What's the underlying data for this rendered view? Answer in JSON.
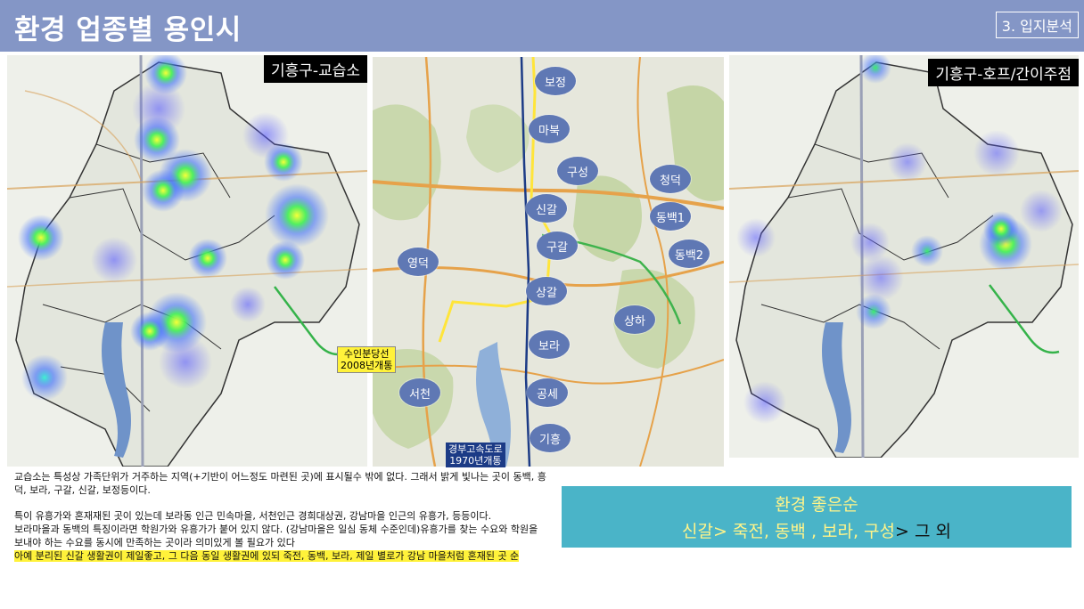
{
  "header": {
    "title": "환경 업종별 용인시",
    "section": "3. 입지분석"
  },
  "maps": {
    "left_label": "기흥구-교습소",
    "right_label": "기흥구-호프/간이주점",
    "center": {
      "districts": [
        "보정",
        "마북",
        "구성",
        "청덕",
        "신갈",
        "동백1",
        "구갈",
        "동백2",
        "영덕",
        "상갈",
        "상하",
        "보라",
        "서천",
        "공세",
        "기흥"
      ],
      "callout_rail": [
        "수인분당선",
        "2008년개통"
      ],
      "callout_highway": [
        "경부고속도로",
        "1970년개통"
      ]
    }
  },
  "text": {
    "p1": "교습소는 특성상 가족단위가 거주하는 지역(+기반이 어느정도 마련된 곳)에 표시될수 밖에 없다. 그래서 밝게 빛나는 곳이 동백, 흥덕, 보라, 구갈, 신갈, 보정등이다.",
    "p2": "특이 유흥가와 혼재재된 곳이 있는데 보라동 인근 민속마을, 서천인근 경희대상권, 강남마을 인근의 유흥가, 등등이다.",
    "p3": "보라마을과 동백의 특징이라면 학원가와 유흥가가 붙어 있지 않다. (강남마을은 일심 동체 수준인데)유흥가를 찾는 수요와 학원을 보내야 하는 수요를 동시에 만족하는 곳이라 의미있게 볼 필요가 있다",
    "p4": "아예 분리된 신갈 생활권이 제일좋고, 그 다음 동일 생활권에 있되 죽전, 동백, 보라, 제일 별로가 강남 마을처럼 혼재된 곳 순"
  },
  "summary": {
    "title": "환경 좋은순",
    "main": "신갈> 죽전, 동백 , 보라, 구성",
    "rest": "> 그 외"
  },
  "colors": {
    "header": "#8496c6",
    "district": "#5f78b4",
    "summary_bg": "#4ab4c8",
    "summary_text": "#fff48a",
    "highlight": "#fff23a"
  }
}
